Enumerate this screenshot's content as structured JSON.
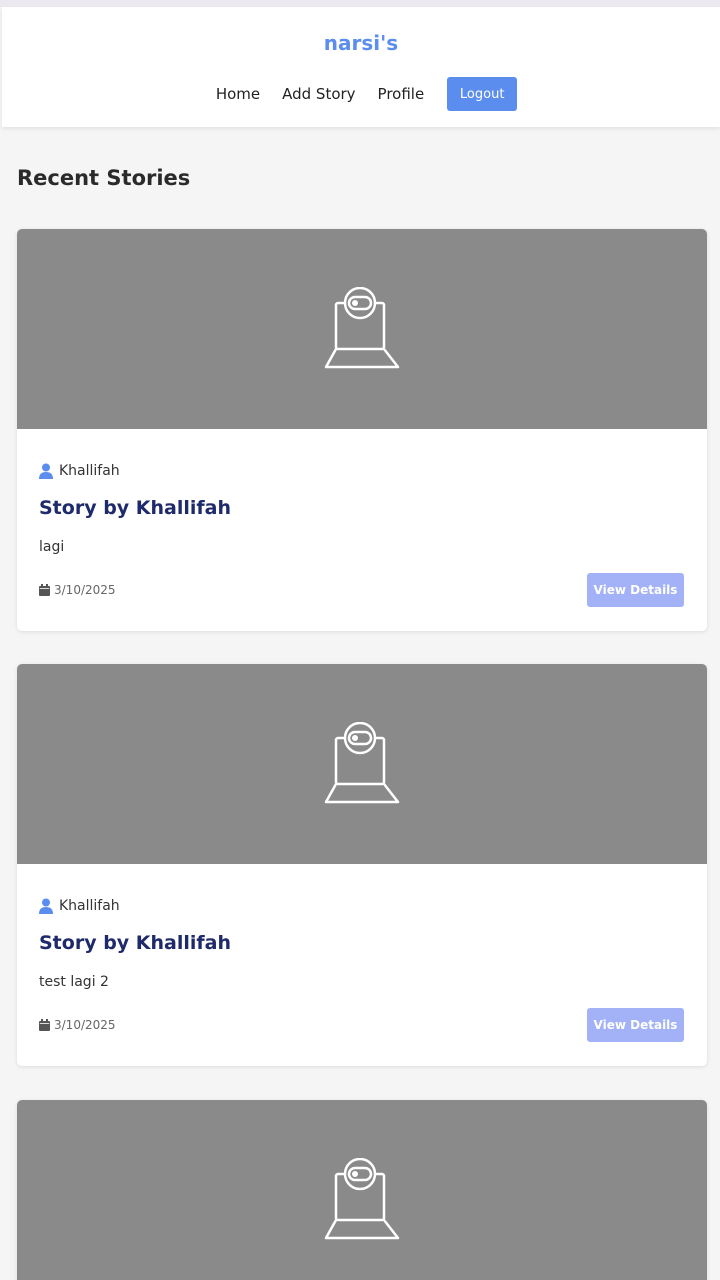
{
  "header": {
    "brand": "narsi's",
    "nav": {
      "home": "Home",
      "add_story": "Add Story",
      "profile": "Profile",
      "logout": "Logout"
    }
  },
  "main": {
    "section_title": "Recent Stories",
    "stories": [
      {
        "image_icon": "webcam-laptop-icon",
        "author": "Khallifah",
        "title": "Story by Khallifah",
        "description": "lagi",
        "date": "3/10/2025",
        "button": "View Details"
      },
      {
        "image_icon": "webcam-laptop-icon",
        "author": "Khallifah",
        "title": "Story by Khallifah",
        "description": "test lagi 2",
        "date": "3/10/2025",
        "button": "View Details"
      },
      {
        "image_icon": "webcam-laptop-icon"
      }
    ]
  },
  "colors": {
    "brand": "#5b8def",
    "title": "#1f2a6b",
    "button_muted": "#a3b2f7",
    "image_placeholder": "#8a8a8a"
  }
}
